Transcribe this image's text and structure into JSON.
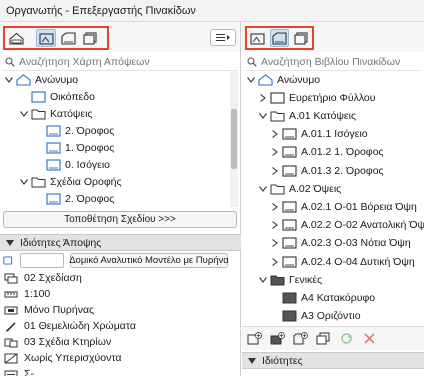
{
  "window": {
    "title": "Οργανωτής - Επεξεργαστής Πινακίδων"
  },
  "left": {
    "search_placeholder": "Αναζήτηση Χάρτη Απόψεων",
    "tree": [
      {
        "label": "Ανώνυμο",
        "indent": 0,
        "arrow": "down",
        "icon": "project"
      },
      {
        "label": "Οικόπεδο",
        "indent": 1,
        "arrow": "",
        "icon": "site"
      },
      {
        "label": "Κατόψεις",
        "indent": 1,
        "arrow": "down",
        "icon": "folder"
      },
      {
        "label": "2. Όροφος",
        "indent": 2,
        "arrow": "",
        "icon": "floor"
      },
      {
        "label": "1. Όροφος",
        "indent": 2,
        "arrow": "",
        "icon": "floor"
      },
      {
        "label": "0. Ισόγειο",
        "indent": 2,
        "arrow": "",
        "icon": "floor"
      },
      {
        "label": "Σχέδια Οροφής",
        "indent": 1,
        "arrow": "down",
        "icon": "folder"
      },
      {
        "label": "2. Όροφος",
        "indent": 2,
        "arrow": "",
        "icon": "floor"
      }
    ],
    "place_button": "Τοποθέτηση Σχεδίου >>>",
    "view_props_title": "Ιδιότητες Άποψης",
    "props": {
      "model_view_value": "Δομικό Αναλυτικό Μοντέλο με Πυρήνα",
      "layer_combo": "02 Σχεδίαση",
      "scale": "1:100",
      "structure": "Μόνο Πυρήνας",
      "pen_set": "01 Θεμελιώδη Χρώματα",
      "model_view_options": "03 Σχέδια Κτηρίων",
      "renovation": "Χωρίς Υπερισχύοντα",
      "last_partial": "Σ-"
    }
  },
  "right": {
    "search_placeholder": "Αναζήτηση Βιβλίου Πινακίδων",
    "tree": [
      {
        "label": "Ανώνυμο",
        "indent": 0,
        "arrow": "down",
        "icon": "project"
      },
      {
        "label": "Ευρετήριο Φύλλου",
        "indent": 1,
        "arrow": "right",
        "icon": "sheet"
      },
      {
        "label": "A.01 Κατόψεις",
        "indent": 1,
        "arrow": "down",
        "icon": "folder"
      },
      {
        "label": "A.01.1 Ισόγειο",
        "indent": 2,
        "arrow": "right",
        "icon": "layout"
      },
      {
        "label": "A.01.2 1. Όροφος",
        "indent": 2,
        "arrow": "right",
        "icon": "layout"
      },
      {
        "label": "A.01.3 2. Όροφος",
        "indent": 2,
        "arrow": "right",
        "icon": "layout"
      },
      {
        "label": "A.02 Όψεις",
        "indent": 1,
        "arrow": "down",
        "icon": "folder"
      },
      {
        "label": "A.02.1 Ο-01 Βόρεια Όψη",
        "indent": 2,
        "arrow": "right",
        "icon": "layout"
      },
      {
        "label": "A.02.2 Ο-02 Ανατολική Όψη",
        "indent": 2,
        "arrow": "right",
        "icon": "layout"
      },
      {
        "label": "A.02.3 Ο-03 Νότια Όψη",
        "indent": 2,
        "arrow": "right",
        "icon": "layout"
      },
      {
        "label": "A.02.4 Ο-04 Δυτική Όψη",
        "indent": 2,
        "arrow": "right",
        "icon": "layout"
      },
      {
        "label": "Γενικές",
        "indent": 1,
        "arrow": "down",
        "icon": "folder-dark"
      },
      {
        "label": "A4 Κατακόρυφο",
        "indent": 2,
        "arrow": "",
        "icon": "master"
      },
      {
        "label": "A3 Οριζόντιο",
        "indent": 2,
        "arrow": "",
        "icon": "master"
      }
    ],
    "props_title": "Ιδιότητες"
  },
  "colors": {
    "highlight": "#e8412c",
    "folder": "#f5c542",
    "accent": "#2b6cc4"
  }
}
